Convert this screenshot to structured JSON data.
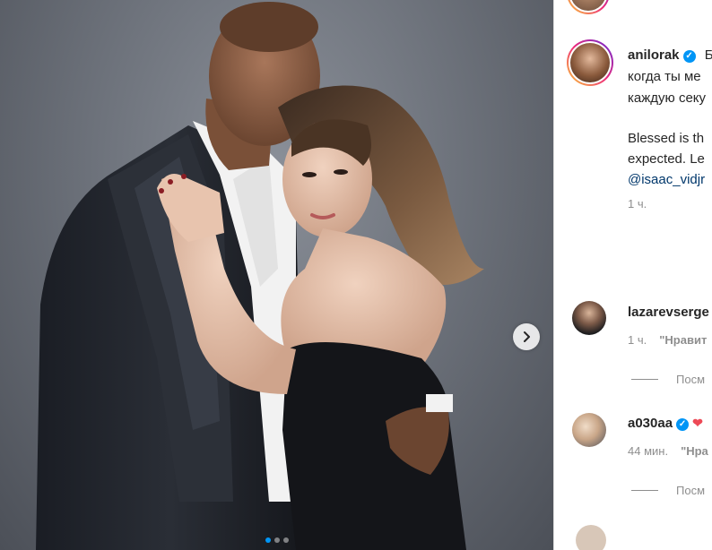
{
  "post": {
    "author": "anilorak",
    "caption_lines": [
      "Б",
      "когда ты ме",
      "каждую секу"
    ],
    "caption_en_lines": [
      "Blessed is th",
      "expected. Le"
    ],
    "mention": "@isaac_vidjr",
    "time": "1 ч."
  },
  "photo": {
    "next_icon": "chevron-right-icon",
    "slides": 3,
    "active_slide": 1
  },
  "comments": [
    {
      "username": "lazarevserge",
      "verified": false,
      "text": "",
      "time": "1 ч.",
      "like_label": "\"Нравит",
      "view_replies": "Посм"
    },
    {
      "username": "a030aa",
      "verified": true,
      "text": "",
      "heart_icon": "red-heart-icon",
      "time": "44 мин.",
      "like_label": "\"Нра",
      "view_replies": "Посм"
    }
  ],
  "colors": {
    "verified": "#0095f6",
    "mention": "#00376b",
    "muted": "#8e8e8e",
    "text": "#262626"
  }
}
